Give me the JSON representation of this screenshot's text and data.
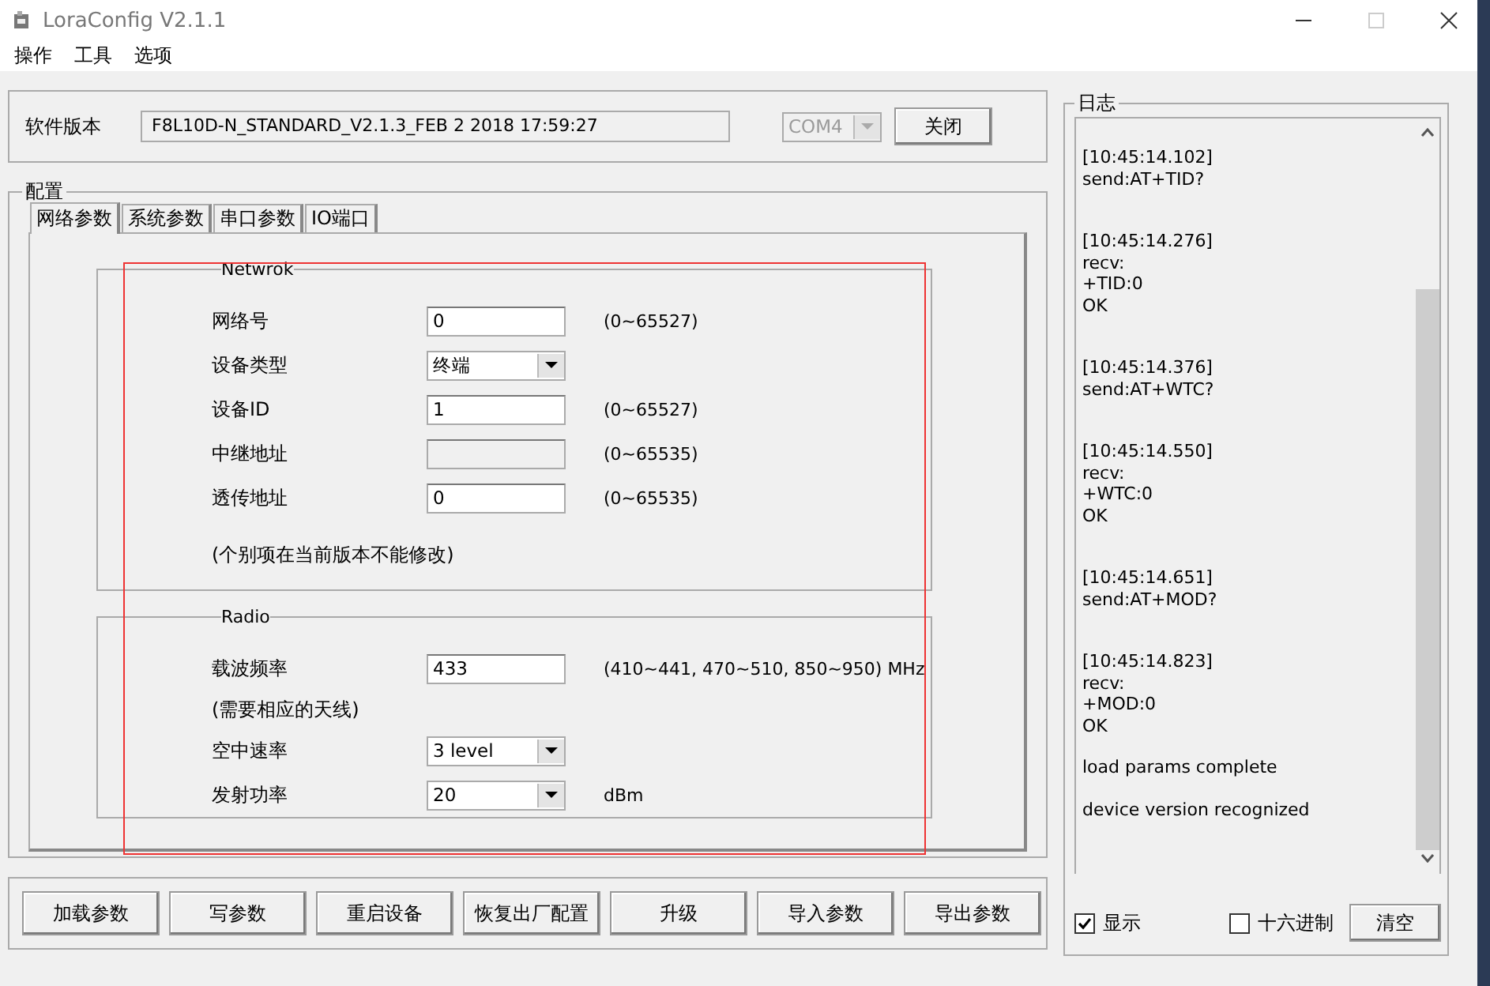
{
  "window": {
    "title": "LoraConfig V2.1.1"
  },
  "menu": [
    "操作",
    "工具",
    "选项"
  ],
  "version": {
    "label": "软件版本",
    "value": "F8L10D-N_STANDARD_V2.1.3_FEB  2 2018 17:59:27",
    "port": "COM4",
    "port_disabled": true,
    "close_button": "关闭"
  },
  "config": {
    "title": "配置",
    "tabs": [
      {
        "label": "网络参数",
        "selected": true
      },
      {
        "label": "系统参数",
        "selected": false
      },
      {
        "label": "串口参数",
        "selected": false
      },
      {
        "label": "IO端口",
        "selected": false
      }
    ],
    "groups": [
      {
        "title": "Netwrok",
        "rows": [
          {
            "kind": "input",
            "label": "网络号",
            "value": "0",
            "hint": "(0~65527)"
          },
          {
            "kind": "select",
            "label": "设备类型",
            "value": "终端"
          },
          {
            "kind": "input",
            "label": "设备ID",
            "value": "1",
            "hint": "(0~65527)"
          },
          {
            "kind": "disabled",
            "label": "中继地址",
            "hint": "(0~65535)"
          },
          {
            "kind": "input",
            "label": "透传地址",
            "value": "0",
            "hint": "(0~65535)"
          },
          {
            "kind": "note",
            "label": "(个别项在当前版本不能修改)"
          }
        ]
      },
      {
        "title": "Radio",
        "rows": [
          {
            "kind": "input",
            "label": "载波频率",
            "value": "433",
            "hint": "(410~441, 470~510, 850~950)  MHz"
          },
          {
            "kind": "note",
            "label": "(需要相应的天线)"
          },
          {
            "kind": "select",
            "label": "空中速率",
            "value": "3 level"
          },
          {
            "kind": "select",
            "label": "发射功率",
            "value": "20",
            "hint": "dBm"
          }
        ]
      }
    ]
  },
  "buttons": [
    "加载参数",
    "写参数",
    "重启设备",
    "恢复出厂配置",
    "升级",
    "导入参数",
    "导出参数"
  ],
  "log": {
    "title": "日志",
    "entries": [
      [
        "[10:45:14.102]",
        "send:AT+TID?"
      ],
      [
        "[10:45:14.276]",
        "recv:",
        "+TID:0",
        "OK"
      ],
      [
        "[10:45:14.376]",
        "send:AT+WTC?"
      ],
      [
        "[10:45:14.550]",
        "recv:",
        "+WTC:0",
        "OK"
      ],
      [
        "[10:45:14.651]",
        "send:AT+MOD?"
      ],
      [
        "[10:45:14.823]",
        "recv:",
        "+MOD:0",
        "OK"
      ],
      [
        "load params complete"
      ],
      [
        "device version recognized"
      ]
    ],
    "show": {
      "label": "显示",
      "checked": true
    },
    "hex": {
      "label": "十六进制",
      "checked": false
    },
    "clear_button": "清空"
  }
}
